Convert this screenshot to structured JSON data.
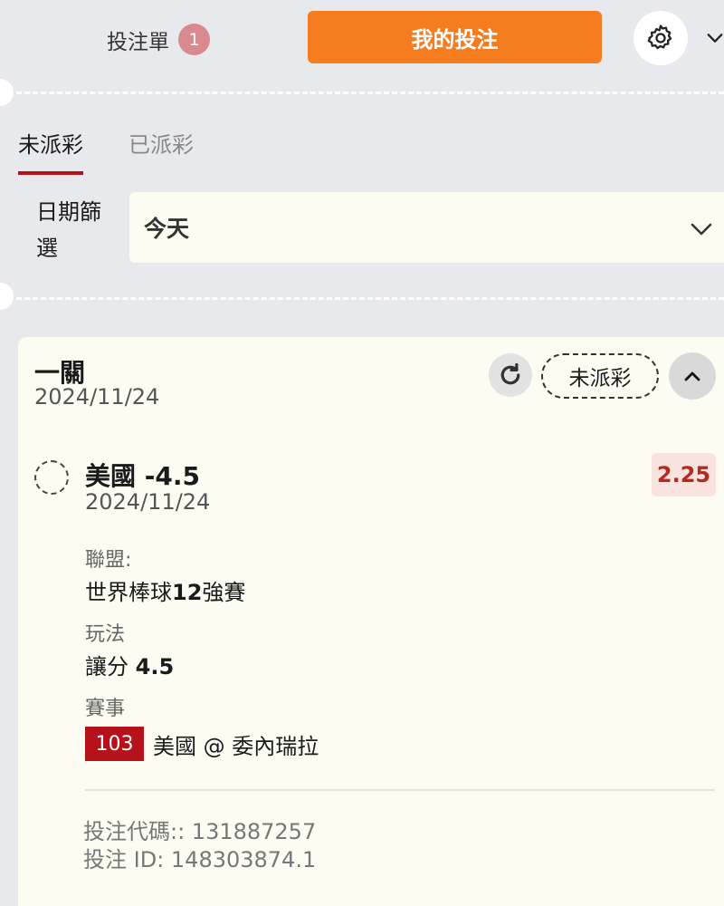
{
  "header": {
    "betslip_label": "投注單",
    "betslip_count": "1",
    "my_bets_label": "我的投注"
  },
  "tabs": [
    {
      "label": "未派彩",
      "active": true
    },
    {
      "label": "已派彩",
      "active": false
    }
  ],
  "date_filter": {
    "label_line1": "日期篩",
    "label_line2": "選",
    "value": "今天"
  },
  "bet_card": {
    "type": "一關",
    "date": "2024/11/24",
    "status": "未派彩",
    "selection": {
      "name": "美國 -4.5",
      "date": "2024/11/24",
      "odds": "2.25"
    },
    "league_label": "聯盟:",
    "league_prefix": "世界棒球",
    "league_bold": "12",
    "league_suffix": "強賽",
    "market_label": "玩法",
    "market_prefix": "讓分 ",
    "market_bold": "4.5",
    "event_label": "賽事",
    "event_no": "103",
    "event_name": "美國 @ 委內瑞拉",
    "bet_code": "投注代碼:: 131887257",
    "bet_id": "投注 ID: 148303874.1"
  },
  "colors": {
    "accent_orange": "#f57c1f",
    "brand_red": "#b5121b",
    "odds_red": "#b22a22"
  }
}
